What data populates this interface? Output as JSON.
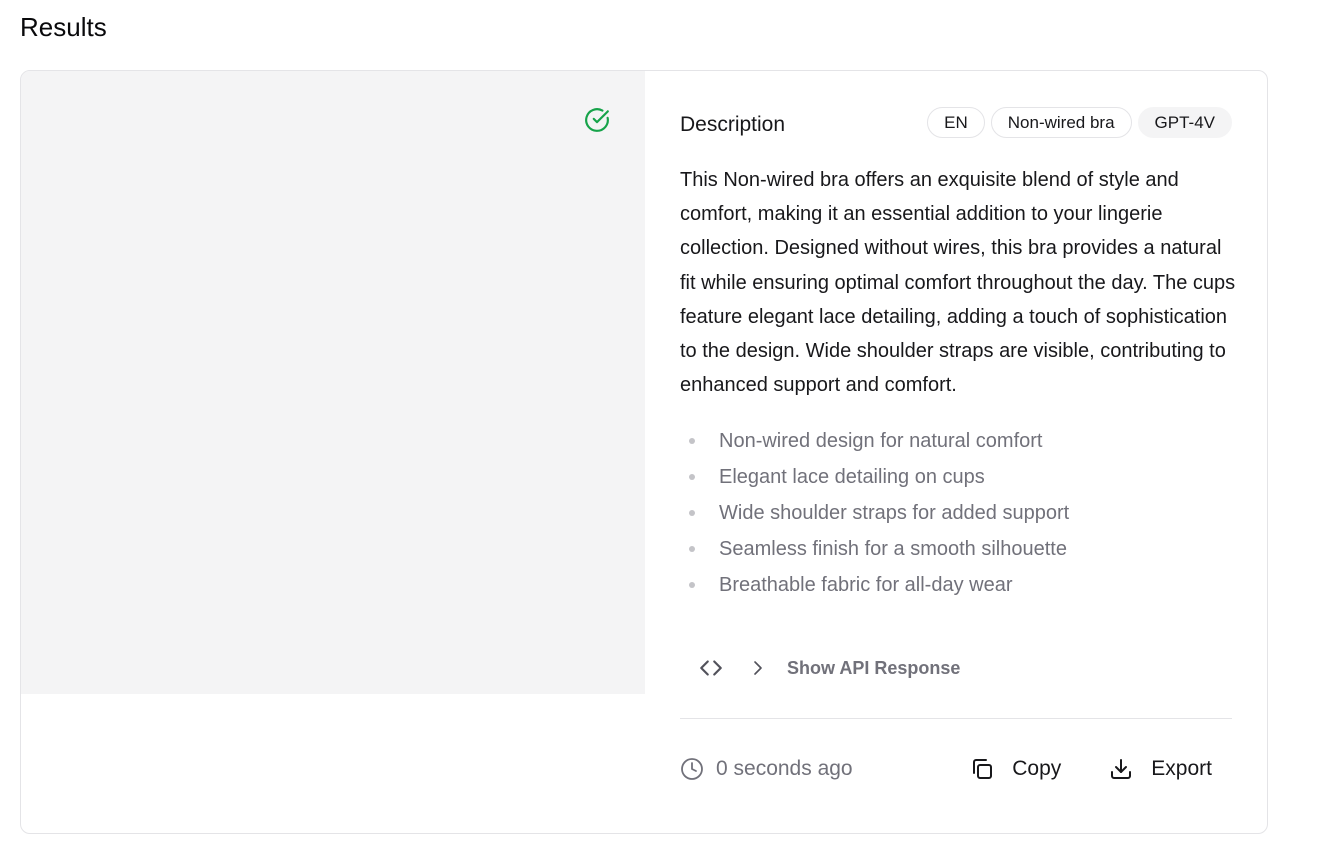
{
  "page": {
    "title": "Results"
  },
  "description": {
    "heading": "Description",
    "badges": {
      "language": "EN",
      "category": "Non-wired bra",
      "model": "GPT-4V"
    },
    "body": "This Non-wired bra offers an exquisite blend of style and comfort, making it an essential addition to your lingerie collection. Designed without wires, this bra provides a natural fit while ensuring optimal comfort throughout the day. The cups feature elegant lace detailing, adding a touch of sophistication to the design. Wide shoulder straps are visible, contributing to enhanced support and comfort.",
    "features": [
      "Non-wired design for natural comfort",
      "Elegant lace detailing on cups",
      "Wide shoulder straps for added support",
      "Seamless finish for a smooth silhouette",
      "Breathable fabric for all-day wear"
    ]
  },
  "api": {
    "toggle_label": "Show API Response"
  },
  "footer": {
    "timestamp": "0 seconds ago",
    "copy_label": "Copy",
    "export_label": "Export"
  },
  "colors": {
    "success": "#16a34a",
    "muted": "#71717a",
    "border": "#e4e4e7"
  },
  "icons": [
    "check-circle-icon",
    "code-icon",
    "chevron-right-icon",
    "clock-icon",
    "copy-icon",
    "download-icon"
  ]
}
